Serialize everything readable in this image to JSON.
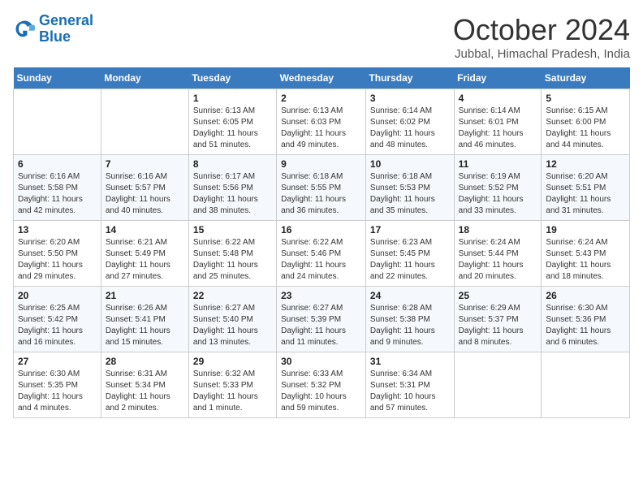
{
  "logo": {
    "line1": "General",
    "line2": "Blue"
  },
  "title": "October 2024",
  "subtitle": "Jubbal, Himachal Pradesh, India",
  "weekdays": [
    "Sunday",
    "Monday",
    "Tuesday",
    "Wednesday",
    "Thursday",
    "Friday",
    "Saturday"
  ],
  "weeks": [
    [
      {
        "day": "",
        "sunrise": "",
        "sunset": "",
        "daylight": ""
      },
      {
        "day": "",
        "sunrise": "",
        "sunset": "",
        "daylight": ""
      },
      {
        "day": "1",
        "sunrise": "Sunrise: 6:13 AM",
        "sunset": "Sunset: 6:05 PM",
        "daylight": "Daylight: 11 hours and 51 minutes."
      },
      {
        "day": "2",
        "sunrise": "Sunrise: 6:13 AM",
        "sunset": "Sunset: 6:03 PM",
        "daylight": "Daylight: 11 hours and 49 minutes."
      },
      {
        "day": "3",
        "sunrise": "Sunrise: 6:14 AM",
        "sunset": "Sunset: 6:02 PM",
        "daylight": "Daylight: 11 hours and 48 minutes."
      },
      {
        "day": "4",
        "sunrise": "Sunrise: 6:14 AM",
        "sunset": "Sunset: 6:01 PM",
        "daylight": "Daylight: 11 hours and 46 minutes."
      },
      {
        "day": "5",
        "sunrise": "Sunrise: 6:15 AM",
        "sunset": "Sunset: 6:00 PM",
        "daylight": "Daylight: 11 hours and 44 minutes."
      }
    ],
    [
      {
        "day": "6",
        "sunrise": "Sunrise: 6:16 AM",
        "sunset": "Sunset: 5:58 PM",
        "daylight": "Daylight: 11 hours and 42 minutes."
      },
      {
        "day": "7",
        "sunrise": "Sunrise: 6:16 AM",
        "sunset": "Sunset: 5:57 PM",
        "daylight": "Daylight: 11 hours and 40 minutes."
      },
      {
        "day": "8",
        "sunrise": "Sunrise: 6:17 AM",
        "sunset": "Sunset: 5:56 PM",
        "daylight": "Daylight: 11 hours and 38 minutes."
      },
      {
        "day": "9",
        "sunrise": "Sunrise: 6:18 AM",
        "sunset": "Sunset: 5:55 PM",
        "daylight": "Daylight: 11 hours and 36 minutes."
      },
      {
        "day": "10",
        "sunrise": "Sunrise: 6:18 AM",
        "sunset": "Sunset: 5:53 PM",
        "daylight": "Daylight: 11 hours and 35 minutes."
      },
      {
        "day": "11",
        "sunrise": "Sunrise: 6:19 AM",
        "sunset": "Sunset: 5:52 PM",
        "daylight": "Daylight: 11 hours and 33 minutes."
      },
      {
        "day": "12",
        "sunrise": "Sunrise: 6:20 AM",
        "sunset": "Sunset: 5:51 PM",
        "daylight": "Daylight: 11 hours and 31 minutes."
      }
    ],
    [
      {
        "day": "13",
        "sunrise": "Sunrise: 6:20 AM",
        "sunset": "Sunset: 5:50 PM",
        "daylight": "Daylight: 11 hours and 29 minutes."
      },
      {
        "day": "14",
        "sunrise": "Sunrise: 6:21 AM",
        "sunset": "Sunset: 5:49 PM",
        "daylight": "Daylight: 11 hours and 27 minutes."
      },
      {
        "day": "15",
        "sunrise": "Sunrise: 6:22 AM",
        "sunset": "Sunset: 5:48 PM",
        "daylight": "Daylight: 11 hours and 25 minutes."
      },
      {
        "day": "16",
        "sunrise": "Sunrise: 6:22 AM",
        "sunset": "Sunset: 5:46 PM",
        "daylight": "Daylight: 11 hours and 24 minutes."
      },
      {
        "day": "17",
        "sunrise": "Sunrise: 6:23 AM",
        "sunset": "Sunset: 5:45 PM",
        "daylight": "Daylight: 11 hours and 22 minutes."
      },
      {
        "day": "18",
        "sunrise": "Sunrise: 6:24 AM",
        "sunset": "Sunset: 5:44 PM",
        "daylight": "Daylight: 11 hours and 20 minutes."
      },
      {
        "day": "19",
        "sunrise": "Sunrise: 6:24 AM",
        "sunset": "Sunset: 5:43 PM",
        "daylight": "Daylight: 11 hours and 18 minutes."
      }
    ],
    [
      {
        "day": "20",
        "sunrise": "Sunrise: 6:25 AM",
        "sunset": "Sunset: 5:42 PM",
        "daylight": "Daylight: 11 hours and 16 minutes."
      },
      {
        "day": "21",
        "sunrise": "Sunrise: 6:26 AM",
        "sunset": "Sunset: 5:41 PM",
        "daylight": "Daylight: 11 hours and 15 minutes."
      },
      {
        "day": "22",
        "sunrise": "Sunrise: 6:27 AM",
        "sunset": "Sunset: 5:40 PM",
        "daylight": "Daylight: 11 hours and 13 minutes."
      },
      {
        "day": "23",
        "sunrise": "Sunrise: 6:27 AM",
        "sunset": "Sunset: 5:39 PM",
        "daylight": "Daylight: 11 hours and 11 minutes."
      },
      {
        "day": "24",
        "sunrise": "Sunrise: 6:28 AM",
        "sunset": "Sunset: 5:38 PM",
        "daylight": "Daylight: 11 hours and 9 minutes."
      },
      {
        "day": "25",
        "sunrise": "Sunrise: 6:29 AM",
        "sunset": "Sunset: 5:37 PM",
        "daylight": "Daylight: 11 hours and 8 minutes."
      },
      {
        "day": "26",
        "sunrise": "Sunrise: 6:30 AM",
        "sunset": "Sunset: 5:36 PM",
        "daylight": "Daylight: 11 hours and 6 minutes."
      }
    ],
    [
      {
        "day": "27",
        "sunrise": "Sunrise: 6:30 AM",
        "sunset": "Sunset: 5:35 PM",
        "daylight": "Daylight: 11 hours and 4 minutes."
      },
      {
        "day": "28",
        "sunrise": "Sunrise: 6:31 AM",
        "sunset": "Sunset: 5:34 PM",
        "daylight": "Daylight: 11 hours and 2 minutes."
      },
      {
        "day": "29",
        "sunrise": "Sunrise: 6:32 AM",
        "sunset": "Sunset: 5:33 PM",
        "daylight": "Daylight: 11 hours and 1 minute."
      },
      {
        "day": "30",
        "sunrise": "Sunrise: 6:33 AM",
        "sunset": "Sunset: 5:32 PM",
        "daylight": "Daylight: 10 hours and 59 minutes."
      },
      {
        "day": "31",
        "sunrise": "Sunrise: 6:34 AM",
        "sunset": "Sunset: 5:31 PM",
        "daylight": "Daylight: 10 hours and 57 minutes."
      },
      {
        "day": "",
        "sunrise": "",
        "sunset": "",
        "daylight": ""
      },
      {
        "day": "",
        "sunrise": "",
        "sunset": "",
        "daylight": ""
      }
    ]
  ]
}
